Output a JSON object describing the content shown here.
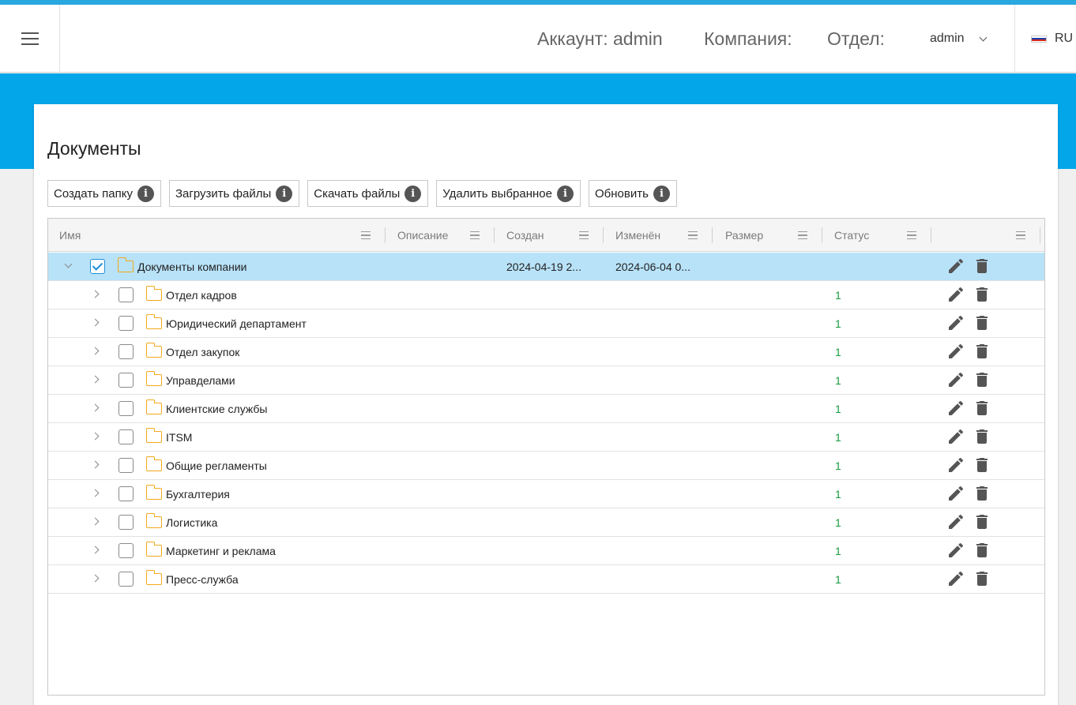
{
  "header": {
    "account": "Аккаунт: admin",
    "company": "Компания:",
    "department": "Отдел:",
    "user": "admin",
    "language": "RU"
  },
  "page": {
    "title": "Документы"
  },
  "toolbar": {
    "create_folder": "Создать папку",
    "upload_files": "Загрузить файлы",
    "download_files": "Скачать файлы",
    "delete_selected": "Удалить выбранное",
    "refresh": "Обновить"
  },
  "columns": {
    "name": "Имя",
    "description": "Описание",
    "created": "Создан",
    "modified": "Изменён",
    "size": "Размер",
    "status": "Статус"
  },
  "root": {
    "name": "Документы компании",
    "created": "2024-04-19 2...",
    "modified": "2024-06-04 0...",
    "checked": true
  },
  "rows": [
    {
      "name": "Отдел кадров",
      "status": "1"
    },
    {
      "name": "Юридический департамент",
      "status": "1"
    },
    {
      "name": "Отдел закупок",
      "status": "1"
    },
    {
      "name": "Управделами",
      "status": "1"
    },
    {
      "name": "Клиентские службы",
      "status": "1"
    },
    {
      "name": "ITSM",
      "status": "1"
    },
    {
      "name": "Общие регламенты",
      "status": "1"
    },
    {
      "name": "Бухгалтерия",
      "status": "1"
    },
    {
      "name": "Логистика",
      "status": "1"
    },
    {
      "name": "Маркетинг и реклама",
      "status": "1"
    },
    {
      "name": "Пресс-служба",
      "status": "1"
    }
  ],
  "colors": {
    "accent": "#04a6ea",
    "selected_row": "#b8e2f8",
    "folder": "#f2a91d",
    "status": "#1a9b3d"
  },
  "icons": [
    "menu-icon",
    "chevron-down-icon",
    "flag-ru-icon",
    "info-icon",
    "column-menu-icon",
    "folder-icon",
    "edit-icon",
    "delete-icon",
    "checkbox-icon",
    "expand-icon"
  ]
}
